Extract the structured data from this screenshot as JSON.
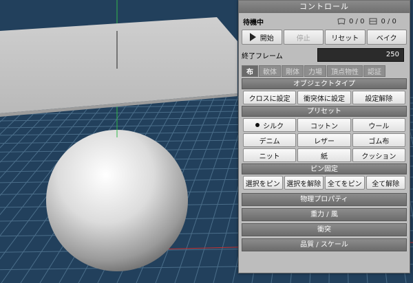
{
  "panel": {
    "title": "コントロール",
    "status": "待機中",
    "stat1_icon": "cloth-count-icon",
    "stat1_value": "0 / 0",
    "stat2_icon": "collider-count-icon",
    "stat2_value": "0 / 0",
    "buttons": {
      "start": "開始",
      "stop": "停止",
      "reset": "リセット",
      "bake": "ベイク"
    },
    "end_frame_label": "終了フレーム",
    "end_frame_value": "250",
    "tabs": [
      "布",
      "軟体",
      "剛体",
      "力場",
      "頂点物性",
      "認証"
    ],
    "active_tab": "布"
  },
  "object_type": {
    "header": "オブジェクトタイプ",
    "buttons": [
      "クロスに設定",
      "衝突体に設定",
      "設定解除"
    ]
  },
  "presets": {
    "header": "プリセット",
    "items": [
      "シルク",
      "コットン",
      "ウール",
      "デニム",
      "レザー",
      "ゴム布",
      "ニット",
      "紙",
      "クッション"
    ],
    "selected": "シルク"
  },
  "pin": {
    "header": "ピン固定",
    "buttons": [
      "選択をピン",
      "選択を解除",
      "全てをピン",
      "全て解除"
    ]
  },
  "collapsed_sections": [
    "物理プロパティ",
    "重力 / 風",
    "衝突",
    "品質 / スケール"
  ],
  "colors": {
    "viewport_bg": "#22405c",
    "grid": "#4b6e8a",
    "axis_x": "#c83232",
    "axis_y": "#31b84a"
  }
}
